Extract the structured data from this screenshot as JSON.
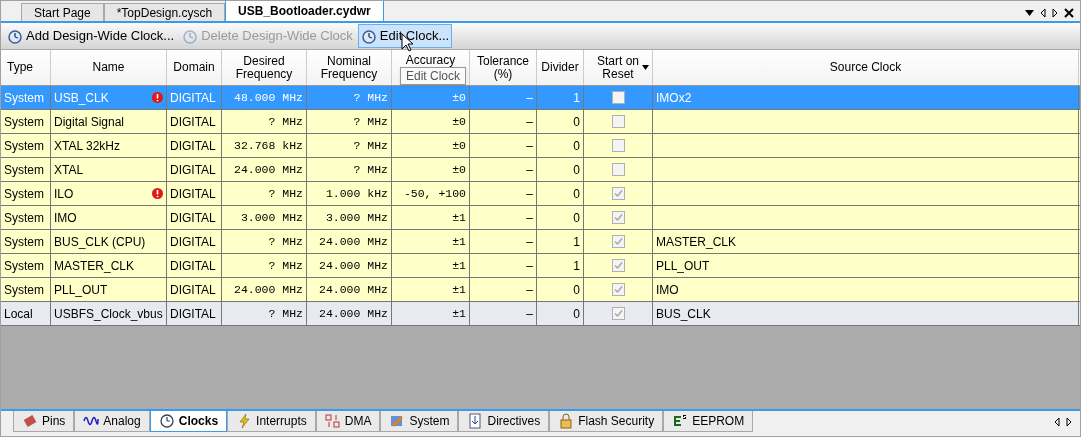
{
  "doc_tabs": [
    {
      "label": "Start Page",
      "selected": false
    },
    {
      "label": "*TopDesign.cysch",
      "selected": false
    },
    {
      "label": "USB_Bootloader.cydwr",
      "selected": true
    }
  ],
  "toolbar": [
    {
      "label": "Add Design-Wide Clock...",
      "disabled": false,
      "hovered": false
    },
    {
      "label": "Delete Design-Wide Clock",
      "disabled": true,
      "hovered": false
    },
    {
      "label": "Edit Clock...",
      "disabled": false,
      "hovered": true
    }
  ],
  "tooltip": "Edit Clock",
  "table": {
    "columns": [
      "Type",
      "Name",
      "Domain",
      "Desired Frequency",
      "Nominal Frequency",
      "Accuracy",
      "Tolerance (%)",
      "Divider",
      "Start on Reset",
      "Source Clock"
    ],
    "rows": [
      {
        "kind": "system",
        "selected": true,
        "warning": true,
        "checked": false,
        "cells": [
          "System",
          "USB_CLK",
          "DIGITAL",
          "48.000 MHz",
          "? MHz",
          "±0",
          "–",
          "1",
          "IMOx2"
        ]
      },
      {
        "kind": "system",
        "selected": false,
        "warning": false,
        "checked": false,
        "cells": [
          "System",
          "Digital Signal",
          "DIGITAL",
          "? MHz",
          "? MHz",
          "±0",
          "–",
          "0",
          ""
        ]
      },
      {
        "kind": "system",
        "selected": false,
        "warning": false,
        "checked": false,
        "cells": [
          "System",
          "XTAL 32kHz",
          "DIGITAL",
          "32.768 kHz",
          "? MHz",
          "±0",
          "–",
          "0",
          ""
        ]
      },
      {
        "kind": "system",
        "selected": false,
        "warning": false,
        "checked": false,
        "cells": [
          "System",
          "XTAL",
          "DIGITAL",
          "24.000 MHz",
          "? MHz",
          "±0",
          "–",
          "0",
          ""
        ]
      },
      {
        "kind": "system",
        "selected": false,
        "warning": true,
        "checked": true,
        "cells": [
          "System",
          "ILO",
          "DIGITAL",
          "? MHz",
          "1.000 kHz",
          "-50, +100",
          "–",
          "0",
          ""
        ]
      },
      {
        "kind": "system",
        "selected": false,
        "warning": false,
        "checked": true,
        "cells": [
          "System",
          "IMO",
          "DIGITAL",
          "3.000 MHz",
          "3.000 MHz",
          "±1",
          "–",
          "0",
          ""
        ]
      },
      {
        "kind": "system",
        "selected": false,
        "warning": false,
        "checked": true,
        "cells": [
          "System",
          "BUS_CLK (CPU)",
          "DIGITAL",
          "? MHz",
          "24.000 MHz",
          "±1",
          "–",
          "1",
          "MASTER_CLK"
        ]
      },
      {
        "kind": "system",
        "selected": false,
        "warning": false,
        "checked": true,
        "cells": [
          "System",
          "MASTER_CLK",
          "DIGITAL",
          "? MHz",
          "24.000 MHz",
          "±1",
          "–",
          "1",
          "PLL_OUT"
        ]
      },
      {
        "kind": "system",
        "selected": false,
        "warning": false,
        "checked": true,
        "cells": [
          "System",
          "PLL_OUT",
          "DIGITAL",
          "24.000 MHz",
          "24.000 MHz",
          "±1",
          "–",
          "0",
          "IMO"
        ]
      },
      {
        "kind": "local",
        "selected": false,
        "warning": false,
        "checked": true,
        "cells": [
          "Local",
          "USBFS_Clock_vbus",
          "DIGITAL",
          "? MHz",
          "24.000 MHz",
          "±1",
          "–",
          "0",
          "BUS_CLK"
        ]
      }
    ]
  },
  "bottom_tabs": [
    {
      "label": "Pins",
      "selected": false
    },
    {
      "label": "Analog",
      "selected": false
    },
    {
      "label": "Clocks",
      "selected": true
    },
    {
      "label": "Interrupts",
      "selected": false
    },
    {
      "label": "DMA",
      "selected": false
    },
    {
      "label": "System",
      "selected": false
    },
    {
      "label": "Directives",
      "selected": false
    },
    {
      "label": "Flash Security",
      "selected": false
    },
    {
      "label": "EEPROM",
      "selected": false
    }
  ]
}
